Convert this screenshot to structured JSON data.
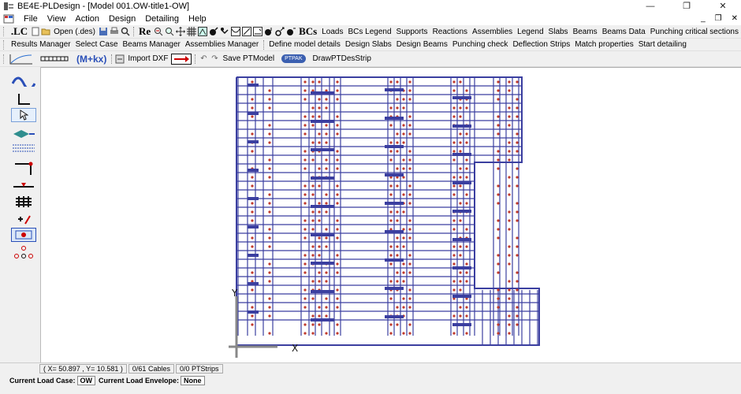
{
  "window": {
    "title": "BE4E-PLDesign - [Model 001.OW-title1-OW]",
    "controls": [
      "—",
      "❐",
      "✕"
    ]
  },
  "menubar": {
    "items": [
      "File",
      "View",
      "Action",
      "Design",
      "Detailing",
      "Help"
    ],
    "mdi_controls": [
      "_",
      "❐",
      "✕"
    ]
  },
  "toolbar1": {
    "lc": ".LC",
    "open": "Open (.des)",
    "re": "Re",
    "bcs": "BCs",
    "items": [
      "Loads",
      "BCs Legend",
      "Supports",
      "Reactions",
      "Assemblies",
      "Legend",
      "Slabs",
      "Beams",
      "Beams Data",
      "Punching critical sections"
    ]
  },
  "toolbar2": {
    "items_a": [
      "Results Manager",
      "Select Case",
      "Beams Manager",
      "Assemblies Manager"
    ],
    "items_b": [
      "Define model details",
      "Design Slabs",
      "Design Beams",
      "Punching check",
      "Deflection Strips",
      "Match properties",
      "Start detailing"
    ]
  },
  "toolbar3": {
    "formula": "(M+kx)",
    "import_dxf": "Import DXF",
    "save_pt": "Save PTModel",
    "ptpak": "PTPAK",
    "draw_strip": "DrawPTDesStrip"
  },
  "canvas": {
    "axis_x": "X",
    "axis_y": "Y"
  },
  "statusbar": {
    "coords": "( X= 50.897 , Y= 10.581 )",
    "cables": "0/61 Cables",
    "strips": "0/0 PTStrips"
  },
  "loadbar": {
    "case_label": "Current Load Case:",
    "case_value": "OW",
    "env_label": "Current Load Envelope:",
    "env_value": "None"
  },
  "colors": {
    "beam": "#3b3fa0",
    "node": "#c0392b"
  }
}
